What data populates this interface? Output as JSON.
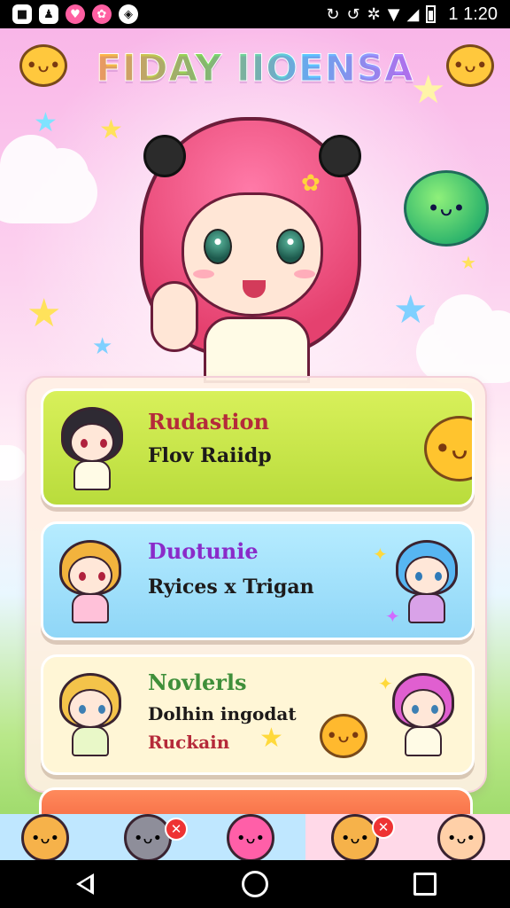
{
  "status_bar": {
    "time": "1 1:20",
    "notification_icons": [
      "notification-square-icon",
      "notification-app-icon",
      "notification-heart-icon",
      "notification-game-icon",
      "notification-game2-icon"
    ],
    "system_icons": [
      "sync-icon",
      "sync2-icon",
      "settings-icon",
      "wifi-icon",
      "signal-icon",
      "battery-icon"
    ]
  },
  "app": {
    "title": "FIDAY IIOENSA"
  },
  "cards": [
    {
      "title": "Rudastion",
      "subtitle": "Flov Raiidp",
      "color": "#c8e84a"
    },
    {
      "title": "Duotunie",
      "subtitle": "Ryices x Trigan",
      "color": "#a3e0fb"
    },
    {
      "title": "Novlerls",
      "subtitle": "Dolhin ingodat",
      "subtitle2": "Ruckain",
      "color": "#fff6d6"
    }
  ],
  "nav": {
    "back": "back-button",
    "home": "home-button",
    "recents": "recents-button"
  }
}
